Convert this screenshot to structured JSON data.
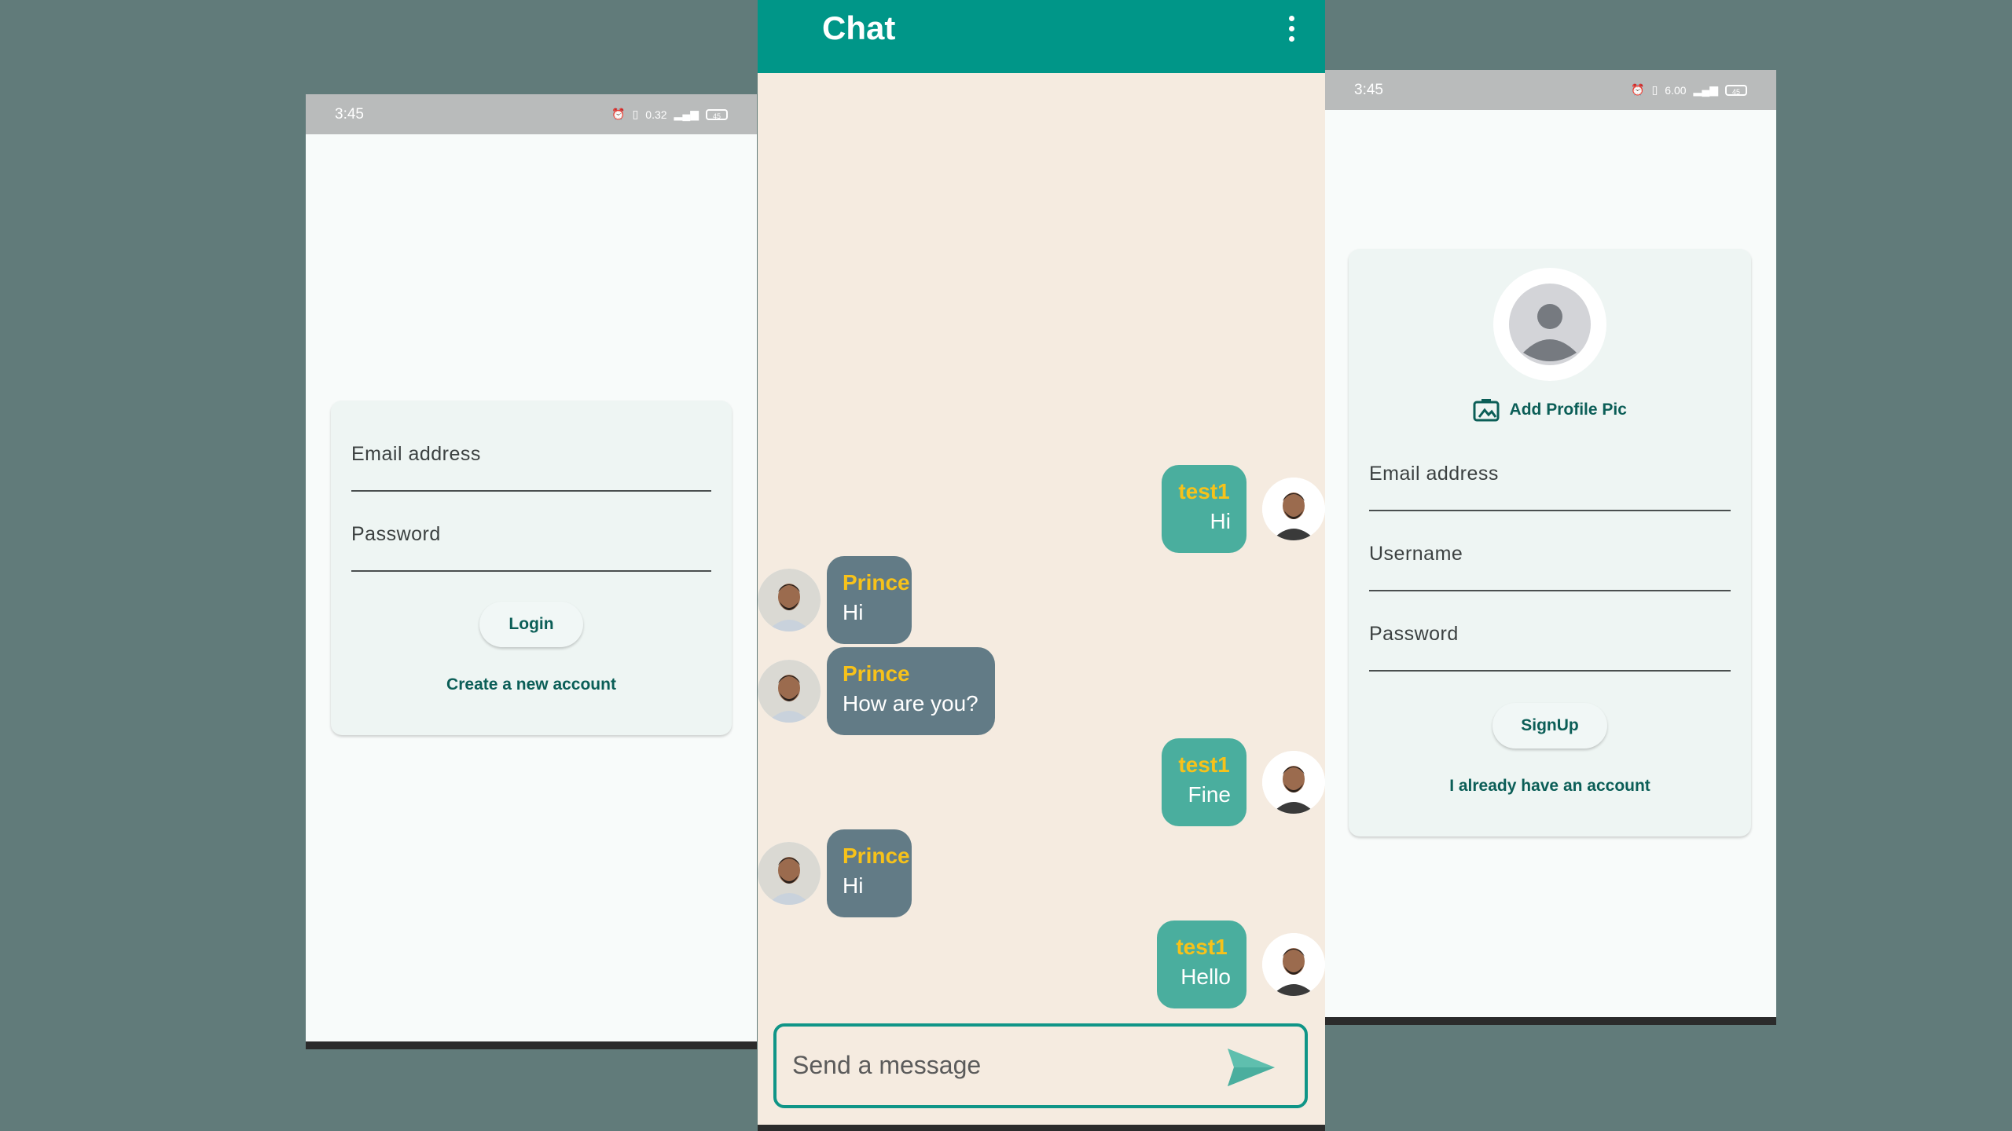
{
  "login_screen": {
    "status_time": "3:45",
    "status_net": "0.32",
    "battery": "45",
    "email_placeholder": "Email address",
    "password_placeholder": "Password",
    "login_label": "Login",
    "create_account_label": "Create a new account"
  },
  "chat_screen": {
    "title": "Chat",
    "messages": [
      {
        "sender": "test1",
        "text": "Hi",
        "direction": "out"
      },
      {
        "sender": "Prince",
        "text": "Hi",
        "direction": "in"
      },
      {
        "sender": "Prince",
        "text": "How are you?",
        "direction": "in"
      },
      {
        "sender": "test1",
        "text": "Fine",
        "direction": "out"
      },
      {
        "sender": "Prince",
        "text": "Hi",
        "direction": "in"
      },
      {
        "sender": "test1",
        "text": "Hello",
        "direction": "out"
      }
    ],
    "composer_placeholder": "Send a message"
  },
  "signup_screen": {
    "status_time": "3:45",
    "status_net": "6.00",
    "battery": "45",
    "add_pic_label": "Add Profile Pic",
    "email_placeholder": "Email address",
    "username_placeholder": "Username",
    "password_placeholder": "Password",
    "signup_label": "SignUp",
    "have_account_label": "I already have an account"
  },
  "colors": {
    "background": "#617b7a",
    "primary": "#009688",
    "accent_text": "#0b5e57",
    "sender_name": "#f7c21a",
    "outgoing_bubble": "#4aae9e",
    "incoming_bubble": "#627b86",
    "chat_background": "#f5ebe0"
  }
}
